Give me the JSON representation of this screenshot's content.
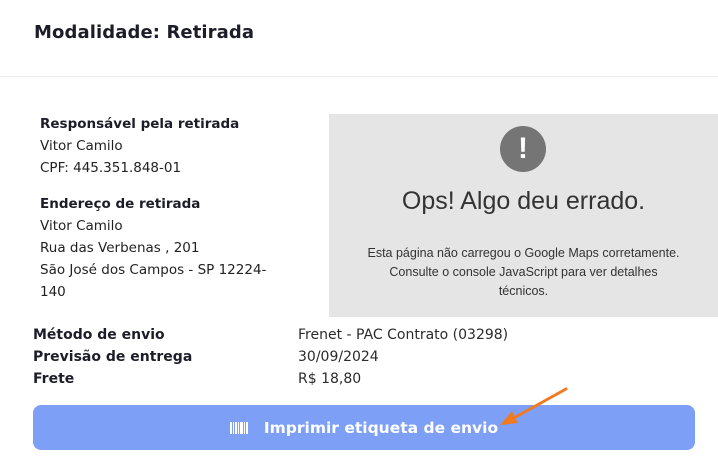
{
  "header": {
    "title": "Modalidade: Retirada"
  },
  "responsible": {
    "label": "Responsável pela retirada",
    "name": "Vitor Camilo",
    "cpf": "CPF: 445.351.848-01"
  },
  "address": {
    "label": "Endereço de retirada",
    "name": "Vitor Camilo",
    "street": "Rua das Verbenas , 201",
    "city_line": "São José dos Campos - SP 12224-",
    "city_line2": "140"
  },
  "map_error": {
    "icon": "!",
    "title": "Ops! Algo deu errado.",
    "message": "Esta página não carregou o Google Maps corretamente. Consulte o console JavaScript para ver detalhes técnicos."
  },
  "shipping": {
    "method_label": "Método de envio",
    "method_value": "Frenet - PAC Contrato (03298)",
    "forecast_label": "Previsão de entrega",
    "forecast_value": "30/09/2024",
    "freight_label": "Frete",
    "freight_value": "R$ 18,80"
  },
  "print_button": {
    "label": "Imprimir etiqueta de envio",
    "icon": "barcode-icon"
  },
  "colors": {
    "button": "#7d9ff6",
    "annotation_arrow": "#f07a22",
    "map_bg": "#e5e5e5"
  }
}
